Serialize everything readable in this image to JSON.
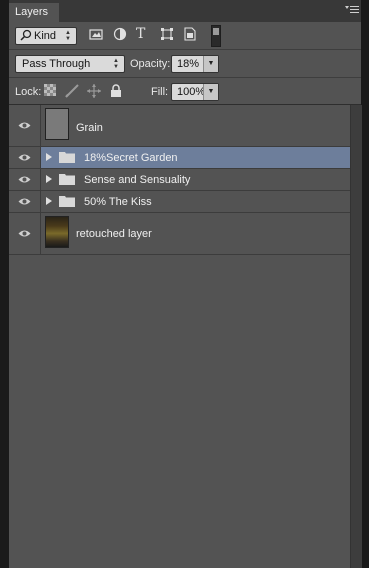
{
  "panel": {
    "tab_label": "Layers",
    "menu_icon": "panel-menu-icon"
  },
  "filter": {
    "kind_label": "Kind",
    "icons": [
      "pixel-layer-filter-icon",
      "adjustment-layer-filter-icon",
      "type-layer-filter-icon",
      "shape-layer-filter-icon",
      "smart-object-filter-icon"
    ],
    "type_glyph": "T"
  },
  "blend": {
    "mode": "Pass Through",
    "opacity_label": "Opacity:",
    "opacity_value": "18%"
  },
  "lock": {
    "label": "Lock:",
    "fill_label": "Fill:",
    "fill_value": "100%"
  },
  "layers": [
    {
      "name": "Grain",
      "type": "pixel",
      "visible": true,
      "selected": false
    },
    {
      "name": "18%Secret Garden",
      "type": "group",
      "visible": true,
      "selected": true
    },
    {
      "name": "Sense and Sensuality",
      "type": "group",
      "visible": true,
      "selected": false
    },
    {
      "name": "50% The Kiss",
      "type": "group",
      "visible": true,
      "selected": false
    },
    {
      "name": "retouched layer",
      "type": "pixel",
      "visible": true,
      "selected": false
    }
  ],
  "colors": {
    "panel_bg": "#535353",
    "selected_row": "#6d7e9b",
    "field_bg": "#dadada"
  }
}
